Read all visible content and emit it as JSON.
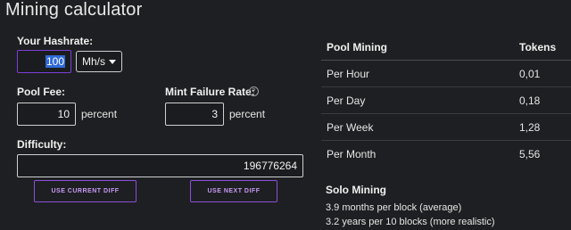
{
  "title": "Mining calculator",
  "hashrate": {
    "label": "Your Hashrate:",
    "value": "100",
    "unit": "Mh/s"
  },
  "pool_fee": {
    "label": "Pool Fee:",
    "value": "10",
    "unit": "percent"
  },
  "mint_failure": {
    "label": "Mint Failure Rate:",
    "value": "3",
    "unit": "percent",
    "help_icon": "question-circle-icon",
    "help_glyph": "?"
  },
  "difficulty": {
    "label": "Difficulty:",
    "value": "196776264"
  },
  "buttons": {
    "current": "USE CURRENT DIFF",
    "next": "USE NEXT DIFF"
  },
  "pool_table": {
    "headers": [
      "Pool Mining",
      "Tokens"
    ],
    "rows": [
      [
        "Per Hour",
        "0,01"
      ],
      [
        "Per Day",
        "0,18"
      ],
      [
        "Per Week",
        "1,28"
      ],
      [
        "Per Month",
        "5,56"
      ]
    ]
  },
  "solo": {
    "title": "Solo Mining",
    "lines": [
      "3.9 months per block (average)",
      "3.2 years per 10 blocks (more realistic)"
    ]
  },
  "colors": {
    "accent": "#8a4fd8",
    "background": "#1e1f22",
    "selection": "#2f6bd6"
  }
}
